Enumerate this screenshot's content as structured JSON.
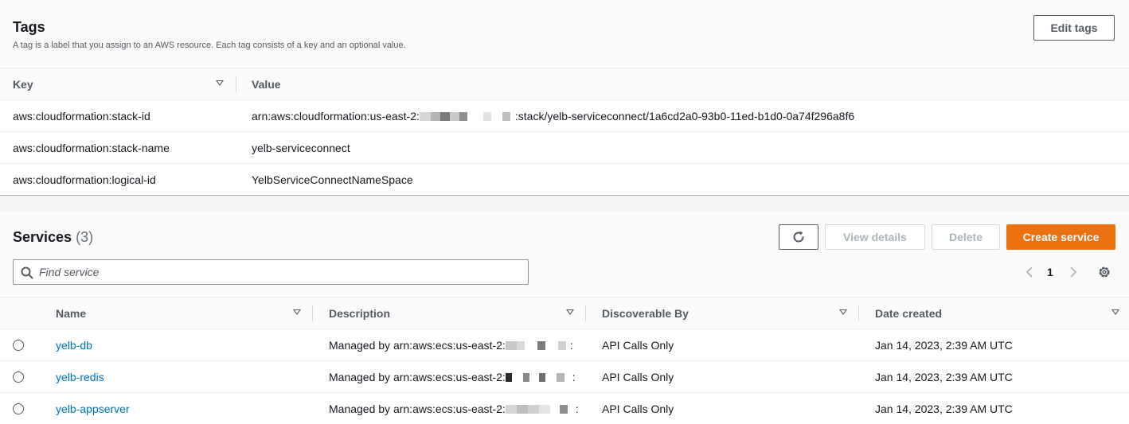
{
  "tags": {
    "title": "Tags",
    "description": "A tag is a label that you assign to an AWS resource. Each tag consists of a key and an optional value.",
    "edit_label": "Edit tags",
    "columns": {
      "key": "Key",
      "value": "Value"
    },
    "rows": [
      {
        "key": "aws:cloudformation:stack-id",
        "value_prefix": "arn:aws:cloudformation:us-east-2:",
        "value_suffix": ":stack/yelb-serviceconnect/1a6cd2a0-93b0-11ed-b1d0-0a74f296a8f6"
      },
      {
        "key": "aws:cloudformation:stack-name",
        "value": "yelb-serviceconnect"
      },
      {
        "key": "aws:cloudformation:logical-id",
        "value": "YelbServiceConnectNameSpace"
      }
    ]
  },
  "services": {
    "title": "Services",
    "count": "(3)",
    "view_details_label": "View details",
    "delete_label": "Delete",
    "create_label": "Create service",
    "search_placeholder": "Find service",
    "page": "1",
    "columns": {
      "name": "Name",
      "description": "Description",
      "discoverable": "Discoverable By",
      "created": "Date created"
    },
    "rows": [
      {
        "name": "yelb-db",
        "description_prefix": "Managed by arn:aws:ecs:us-east-2:",
        "description_suffix": ":",
        "discoverable": "API Calls Only",
        "created": "Jan 14, 2023, 2:39 AM UTC"
      },
      {
        "name": "yelb-redis",
        "description_prefix": "Managed by arn:aws:ecs:us-east-2:",
        "description_suffix": ":",
        "discoverable": "API Calls Only",
        "created": "Jan 14, 2023, 2:39 AM UTC"
      },
      {
        "name": "yelb-appserver",
        "description_prefix": "Managed by arn:aws:ecs:us-east-2:",
        "description_suffix": ":",
        "discoverable": "API Calls Only",
        "created": "Jan 14, 2023, 2:39 AM UTC"
      }
    ]
  },
  "icons": {
    "refresh": "refresh-icon",
    "search": "search-icon",
    "prev": "chevron-left-icon",
    "next": "chevron-right-icon",
    "settings": "gear-icon"
  },
  "colors": {
    "primary": "#ec7211",
    "link": "#0073bb",
    "text": "#16191f",
    "muted": "#545b64"
  }
}
